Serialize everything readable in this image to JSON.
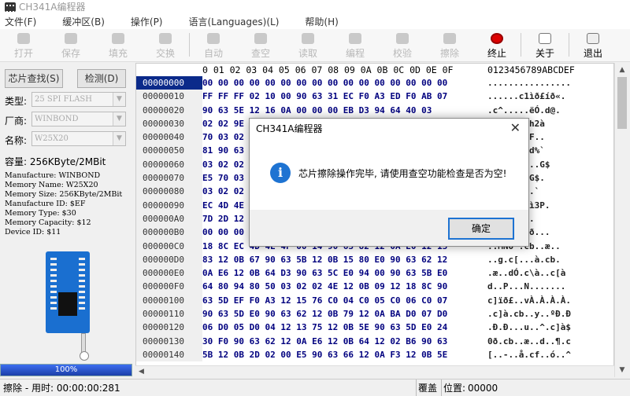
{
  "window": {
    "title": "CH341A编程器"
  },
  "menu": [
    "文件(F)",
    "缓冲区(B)",
    "操作(P)",
    "语言(Languages)(L)",
    "帮助(H)"
  ],
  "toolbar": {
    "open": "打开",
    "save": "保存",
    "fill": "填充",
    "swap": "交换",
    "auto": "自动",
    "blank_check": "查空",
    "read": "读取",
    "program": "编程",
    "verify": "校验",
    "erase": "擦除",
    "stop": "终止",
    "about": "关于",
    "exit": "退出"
  },
  "left": {
    "find_chip": "芯片查找(S)",
    "detect": "检测(D)",
    "type_label": "类型:",
    "type_value": "25 SPI FLASH",
    "vendor_label": "厂商:",
    "vendor_value": "WINBOND",
    "name_label": "名称:",
    "name_value": "W25X20",
    "capacity": "容量: 256KByte/2MBit",
    "info": [
      "Manufacture: WINBOND",
      "Memory Name: W25X20",
      "Memory Size: 256KByte/2MBit",
      "Manufacture ID: $EF",
      "Memory Type: $30",
      "Memory Capacity: $12",
      "Device ID: $11"
    ],
    "progress": "100%",
    "progress_value": 1.0
  },
  "hex": {
    "header_cols": "0 01 02 03 04 05 06 07 08 09 0A 0B 0C 0D 0E 0F",
    "header_ascii": "0123456789ABCDEF",
    "rows": [
      {
        "addr": "00000000",
        "hex": "00 00 00 00 00 00 00 00 00 00 00 00 00 00 00 00",
        "ascii": "................"
      },
      {
        "addr": "00000010",
        "hex": "FF FF FF 02 10 00 90 63 31 EC F0 A3 ED F0 AB 07",
        "ascii": "......c1ìð£íð«."
      },
      {
        "addr": "00000020",
        "hex": "90 63 5E 12 16 0A 00 00 00 EB D3 94 64 40 03",
        "ascii": ".c^.....ëÓ.d@."
      },
      {
        "addr": "00000030",
        "hex": "02 02 9E",
        "ascii": "ì`à`....h2à"
      },
      {
        "addr": "00000040",
        "hex": "70 03 02",
        "ascii": "{.zcy3°cF.."
      },
      {
        "addr": "00000050",
        "hex": "81 90 63",
        "ascii": ".£-p...md%`"
      },
      {
        "addr": "00000060",
        "hex": "03 02 02",
        "ascii": "cI...mp...G$"
      },
      {
        "addr": "00000070",
        "hex": "E5 70 03",
        "ascii": ".`$üp...G$."
      },
      {
        "addr": "00000080",
        "hex": "03 02 02",
        "ascii": "cf..õ....`"
      },
      {
        "addr": "00000090",
        "hex": "EC 4D 4E",
        "ascii": "p...^...ì3P."
      },
      {
        "addr": "000000A0",
        "hex": "7D 2D 12",
        "ascii": "..Ç..^cb."
      },
      {
        "addr": "000000B0",
        "hex": "00 00 00",
        "ascii": "ã.æ[c[ðÆð..."
      },
      {
        "addr": "000000C0",
        "hex": "18 8C EC 4D 4E 4F 00 14 90 63 82 12 0A E0 12 13",
        "ascii": "..MNO`.cb..æ.."
      },
      {
        "addr": "000000D0",
        "hex": "83 12 0B 67 90 63 5B 12 0B 15 80 E0 90 63 62 12",
        "ascii": "..g.c[...à.cb."
      },
      {
        "addr": "000000E0",
        "hex": "0A E6 12 0B 64 D3 90 63 5C E0 94 00 90 63 5B E0",
        "ascii": ".æ..dÓ.c\\à..c[à"
      },
      {
        "addr": "000000F0",
        "hex": "64 80 94 80 50 03 02 02 4E 12 0B 09 12 18 8C 90",
        "ascii": "d..P...N......."
      },
      {
        "addr": "00000100",
        "hex": "63 5D EF F0 A3 12 15 76 C0 04 C0 05 C0 06 C0 07",
        "ascii": "c]ïð£..vÀ.À.À.À."
      },
      {
        "addr": "00000110",
        "hex": "90 63 5D E0 90 63 62 12 0B 79 12 0A BA D0 07 D0",
        "ascii": ".c]à.cb..y..ºÐ.Ð"
      },
      {
        "addr": "00000120",
        "hex": "06 D0 05 D0 04 12 13 75 12 0B 5E 90 63 5D E0 24",
        "ascii": ".Ð.Ð...u..^.c]à$"
      },
      {
        "addr": "00000130",
        "hex": "30 F0 90 63 62 12 0A E6 12 0B 64 12 02 B6 90 63",
        "ascii": "0ð.cb..æ..d..¶.c"
      },
      {
        "addr": "00000140",
        "hex": "5B 12 0B 2D 02 00 E5 90 63 66 12 0A F3 12 0B 5E",
        "ascii": "[..-..å.cf..ó..^"
      }
    ]
  },
  "status": {
    "left": "擦除 - 用时: 00:00:00:281",
    "mode": "覆盖",
    "pos_label": "位置:",
    "pos_value": "00000"
  },
  "dialog": {
    "title": "CH341A编程器",
    "message": "芯片擦除操作完毕, 请使用查空功能检查是否为空!",
    "ok": "确定"
  },
  "colors": {
    "selection": "#0b2a8a",
    "hex_text": "#00007f",
    "info_icon": "#1e73d2",
    "progress": "#1b3ea8"
  }
}
